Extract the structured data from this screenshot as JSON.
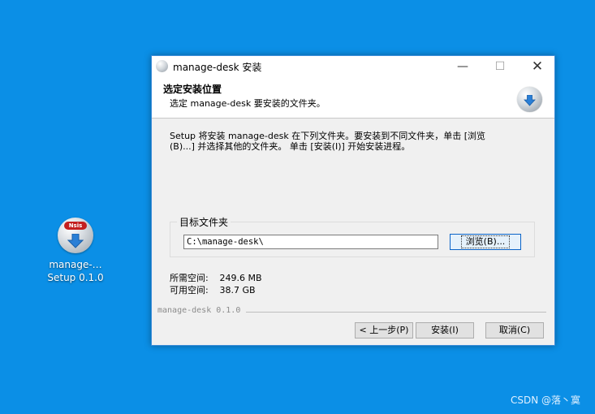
{
  "desktop": {
    "icon": {
      "label_line1": "manage-…",
      "label_line2": "Setup 0.1.0",
      "badge": "Nsis"
    },
    "watermark": "CSDN @落丶寞"
  },
  "window": {
    "title": "manage-desk 安装",
    "controls": {
      "minimize": "—",
      "maximize": "☐",
      "close": "✕"
    },
    "header": {
      "title": "选定安装位置",
      "subtitle": "选定 manage-desk 要安装的文件夹。"
    },
    "intro": "Setup 将安装 manage-desk 在下列文件夹。要安装到不同文件夹，单击 [浏览\n(B)...] 并选择其他的文件夹。 单击 [安装(I)] 开始安装进程。",
    "destination": {
      "legend": "目标文件夹",
      "path": "C:\\manage-desk\\",
      "browse_label": "浏览(B)..."
    },
    "space": {
      "required_label": "所需空间:",
      "required_value": "249.6 MB",
      "available_label": "可用空间:",
      "available_value": "38.7 GB"
    },
    "brand": "manage-desk 0.1.0",
    "buttons": {
      "back": "< 上一步(P)",
      "install": "安装(I)",
      "cancel": "取消(C)"
    }
  }
}
